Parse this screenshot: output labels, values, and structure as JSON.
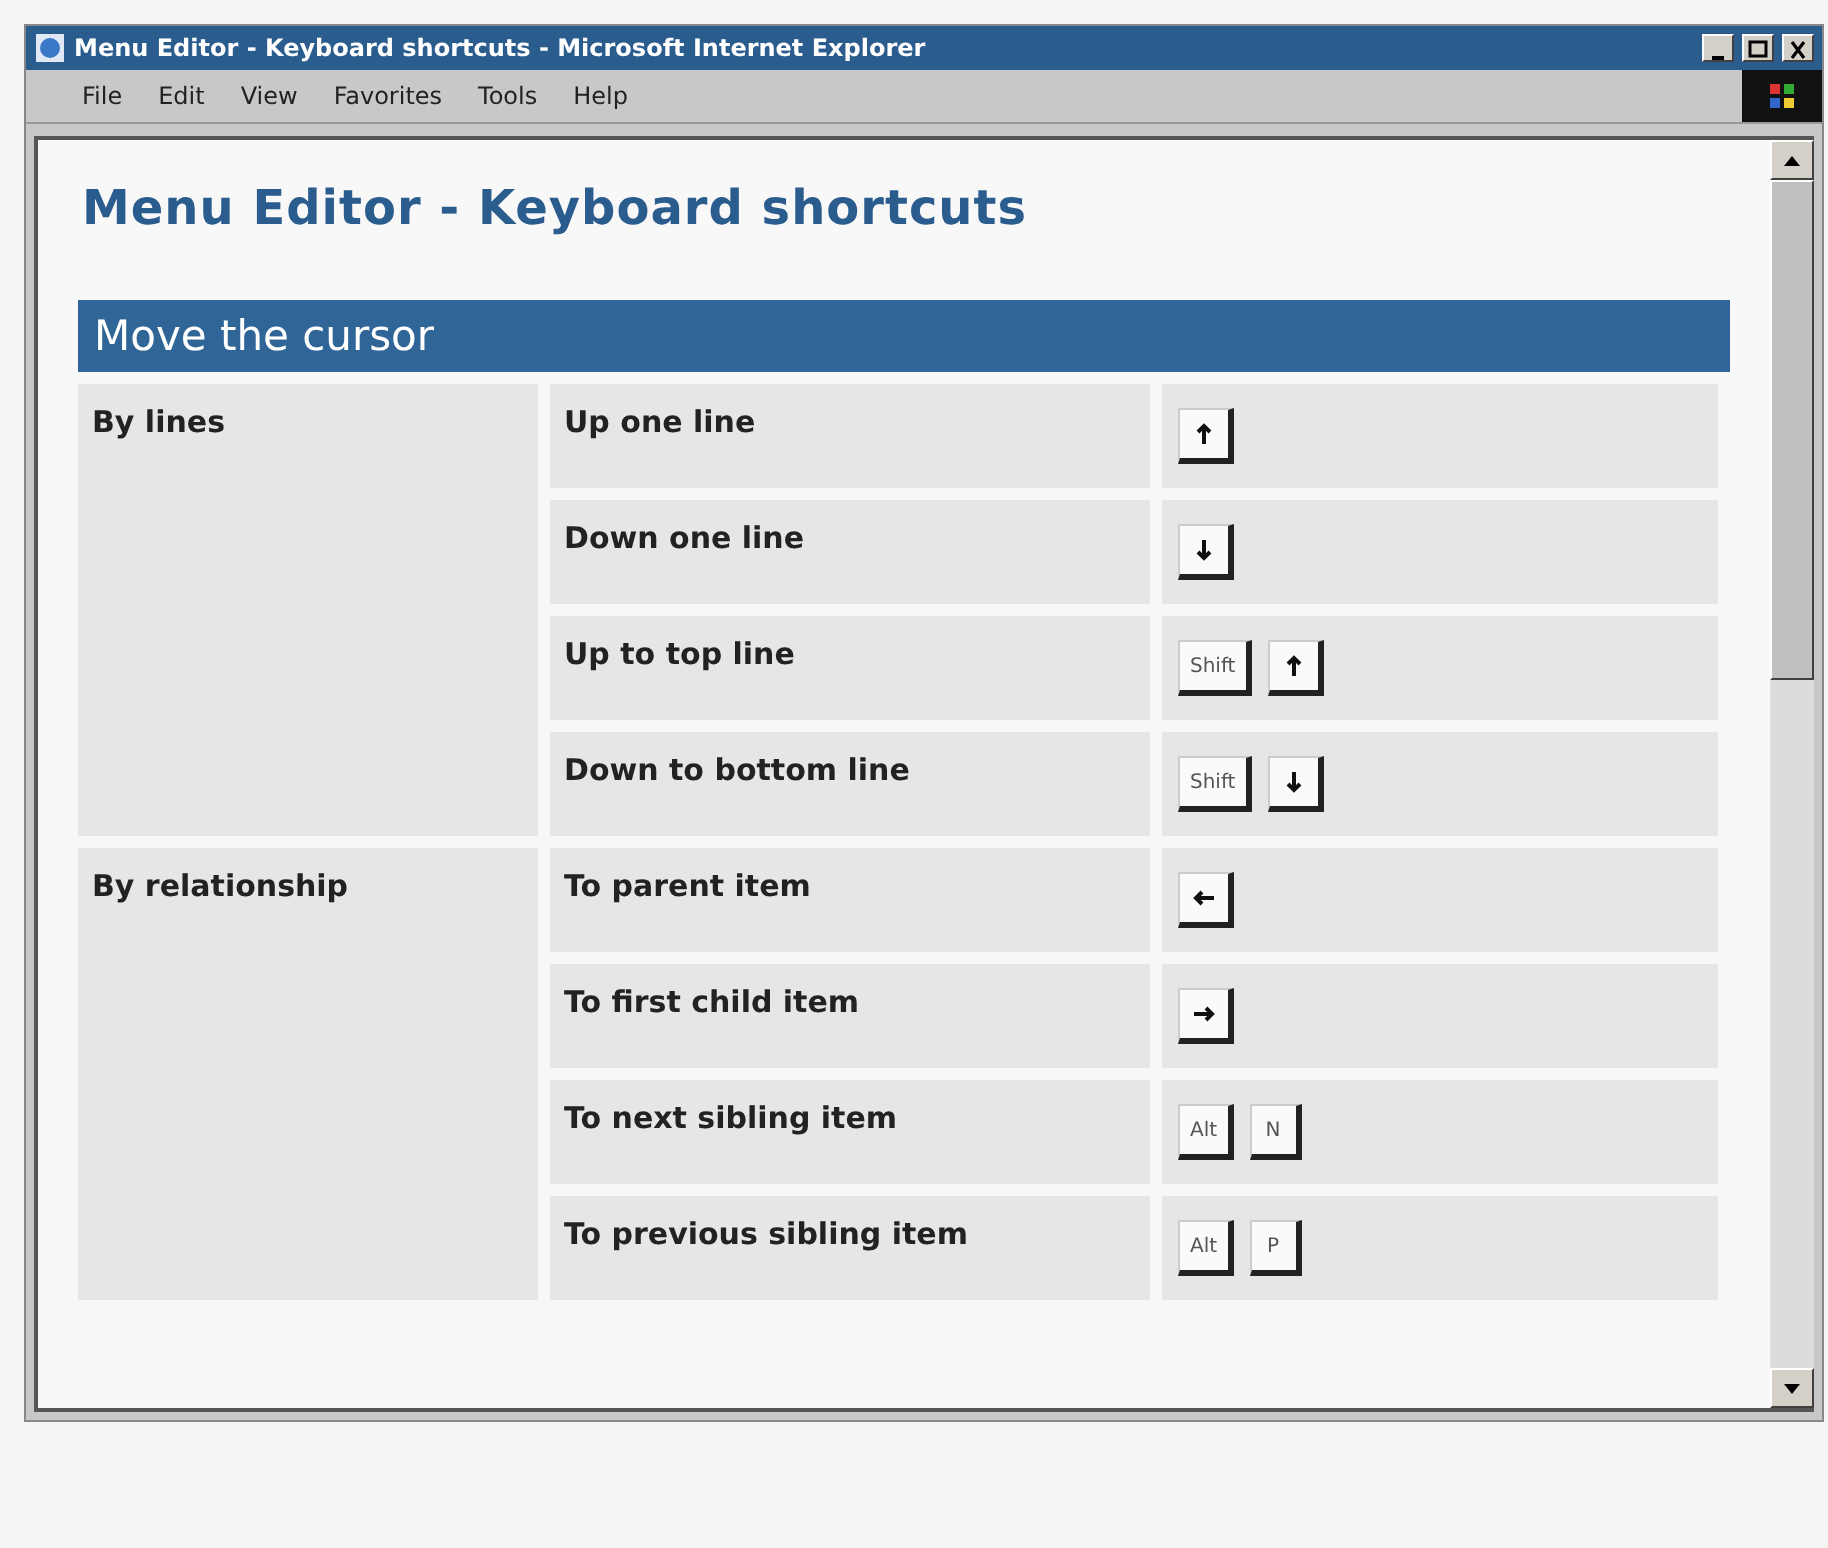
{
  "window": {
    "title": "Menu Editor - Keyboard shortcuts - Microsoft Internet Explorer"
  },
  "menu": [
    "File",
    "Edit",
    "View",
    "Favorites",
    "Tools",
    "Help"
  ],
  "page_title": "Menu Editor - Keyboard shortcuts",
  "section": {
    "title": "Move the cursor",
    "groups": [
      {
        "label": "By lines",
        "rows": [
          {
            "action": "Up one line",
            "keys": [
              {
                "kind": "up"
              }
            ]
          },
          {
            "action": "Down one line",
            "keys": [
              {
                "kind": "down"
              }
            ]
          },
          {
            "action": "Up to top line",
            "keys": [
              {
                "kind": "text",
                "label": "Shift"
              },
              {
                "kind": "up"
              }
            ]
          },
          {
            "action": "Down to bottom line",
            "keys": [
              {
                "kind": "text",
                "label": "Shift"
              },
              {
                "kind": "down"
              }
            ]
          }
        ]
      },
      {
        "label": "By relationship",
        "rows": [
          {
            "action": "To parent item",
            "keys": [
              {
                "kind": "left"
              }
            ]
          },
          {
            "action": "To first child item",
            "keys": [
              {
                "kind": "right"
              }
            ]
          },
          {
            "action": "To next sibling item",
            "keys": [
              {
                "kind": "text",
                "label": "Alt"
              },
              {
                "kind": "text",
                "label": "N"
              }
            ]
          },
          {
            "action": "To previous sibling item",
            "keys": [
              {
                "kind": "text",
                "label": "Alt"
              },
              {
                "kind": "text",
                "label": "P"
              }
            ]
          }
        ]
      }
    ]
  }
}
